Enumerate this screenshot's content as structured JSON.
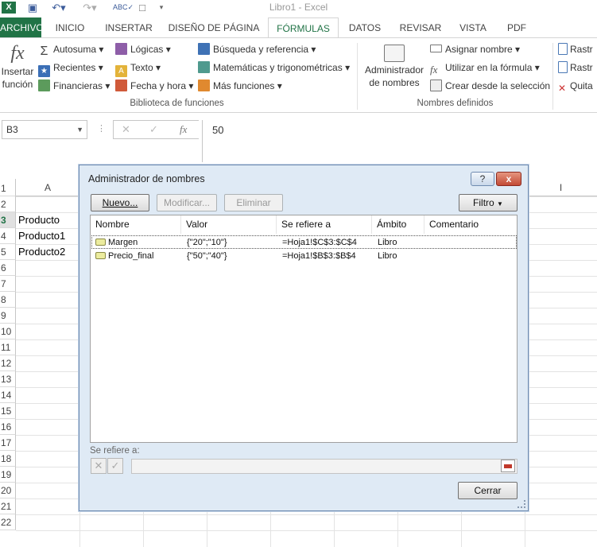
{
  "window": {
    "title": "Libro1 - Excel"
  },
  "ribbon_tabs": [
    "ARCHIVO",
    "INICIO",
    "INSERTAR",
    "DISEÑO DE PÁGINA",
    "FÓRMULAS",
    "DATOS",
    "REVISAR",
    "VISTA",
    "PDF"
  ],
  "ribbon": {
    "insert_function": [
      "Insertar",
      "función"
    ],
    "autosum": "Autosuma",
    "recent": "Recientes",
    "financial": "Financieras",
    "logical": "Lógicas",
    "text": "Texto",
    "datetime": "Fecha y hora",
    "lookup": "Búsqueda y referencia",
    "math": "Matemáticas y trigonométricas",
    "more": "Más funciones",
    "group_library": "Biblioteca de funciones",
    "name_manager": [
      "Administrador",
      "de nombres"
    ],
    "define_name": "Asignar nombre",
    "use_in_formula": "Utilizar en la fórmula",
    "create_from_selection": "Crear desde la selección",
    "group_names": "Nombres definidos",
    "trace_precedents": "Rastr",
    "trace_dependents": "Rastr",
    "remove_arrows": "Quita"
  },
  "formula_bar": {
    "name_box": "B3",
    "formula": "50",
    "fx": "fx"
  },
  "columns": [
    "A",
    "I"
  ],
  "rows": [
    "1",
    "2",
    "3",
    "4",
    "5",
    "6",
    "7",
    "8",
    "9",
    "10",
    "11",
    "12",
    "13",
    "14",
    "15",
    "16",
    "17",
    "18",
    "19",
    "20",
    "21",
    "22"
  ],
  "cells": {
    "A2": "Producto",
    "A3": "Producto1",
    "A4": "Producto2"
  },
  "dialog": {
    "title": "Administrador de nombres",
    "help": "?",
    "close_x": "x",
    "new_btn": "Nuevo...",
    "edit_btn": "Modificar...",
    "delete_btn": "Eliminar",
    "filter_btn": "Filtro",
    "headers": [
      "Nombre",
      "Valor",
      "Se refiere a",
      "Ámbito",
      "Comentario"
    ],
    "rows": [
      {
        "name": "Margen",
        "value": "{\"20\";\"10\"}",
        "refers": "=Hoja1!$C$3:$C$4",
        "scope": "Libro",
        "comment": ""
      },
      {
        "name": "Precio_final",
        "value": "{\"50\";\"40\"}",
        "refers": "=Hoja1!$B$3:$B$4",
        "scope": "Libro",
        "comment": ""
      }
    ],
    "refers_label": "Se refiere a:",
    "close_btn": "Cerrar"
  }
}
